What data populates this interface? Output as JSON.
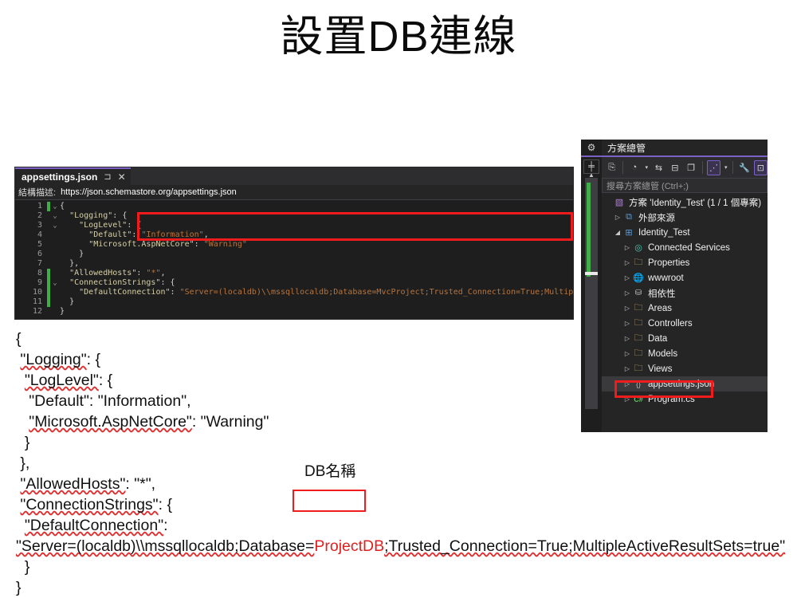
{
  "slide": {
    "title": "設置DB連線"
  },
  "editor": {
    "tab": {
      "title": "appsettings.json",
      "pin_icon": "pin-icon",
      "close_icon": "close-icon"
    },
    "schema": {
      "label": "結構描述:",
      "url": "https://json.schemastore.org/appsettings.json"
    },
    "lines": [
      {
        "num": "1",
        "fold": "⌄",
        "changed": true,
        "indent": "",
        "text": "{"
      },
      {
        "num": "2",
        "fold": "⌄",
        "changed": false,
        "indent": "",
        "text": "  \"Logging\": {"
      },
      {
        "num": "3",
        "fold": "⌄",
        "changed": false,
        "indent": "",
        "text": "    \"LogLevel\": {"
      },
      {
        "num": "4",
        "fold": "",
        "changed": false,
        "indent": "",
        "text": "      \"Default\": \"Information\","
      },
      {
        "num": "5",
        "fold": "",
        "changed": false,
        "indent": "",
        "text": "      \"Microsoft.AspNetCore\": \"Warning\""
      },
      {
        "num": "6",
        "fold": "",
        "changed": false,
        "indent": "",
        "text": "    }"
      },
      {
        "num": "7",
        "fold": "",
        "changed": false,
        "indent": "",
        "text": "  },"
      },
      {
        "num": "8",
        "fold": "",
        "changed": true,
        "indent": "",
        "text": "  \"AllowedHosts\": \"*\","
      },
      {
        "num": "9",
        "fold": "⌄",
        "changed": true,
        "indent": "",
        "text": "  \"ConnectionStrings\": {"
      },
      {
        "num": "10",
        "fold": "",
        "changed": true,
        "indent": "",
        "text": "    \"DefaultConnection\": \"Server=(localdb)\\\\mssqllocaldb;Database=MvcProject;Trusted_Connection=True;MultipleActiveResultSets=true\""
      },
      {
        "num": "11",
        "fold": "",
        "changed": true,
        "indent": "",
        "text": "  }"
      },
      {
        "num": "12",
        "fold": "",
        "changed": false,
        "indent": "",
        "text": "}"
      }
    ],
    "highlight_color": "#ee1c1c"
  },
  "solution_explorer": {
    "header": "方案總管",
    "search_placeholder": "搜尋方案總管 (Ctrl+;)",
    "gear_icon": "gear-icon",
    "pin_icon": "pin-icon",
    "toolbar": [
      {
        "name": "home-icon",
        "glyph": "⎘",
        "framed": false,
        "caret": false
      },
      {
        "name": "pending-changes-icon",
        "glyph": "◔",
        "framed": false,
        "caret": true
      },
      {
        "name": "sync-icon",
        "glyph": "⇆",
        "framed": false,
        "caret": false
      },
      {
        "name": "collapse-all-icon",
        "glyph": "⊟",
        "framed": false,
        "caret": false
      },
      {
        "name": "show-all-files-icon",
        "glyph": "❐",
        "framed": false,
        "caret": false
      },
      {
        "name": "view-switch-icon",
        "glyph": "⋰",
        "framed": true,
        "caret": true
      },
      {
        "name": "properties-icon",
        "glyph": "🔧",
        "framed": false,
        "caret": false
      },
      {
        "name": "preview-icon",
        "glyph": "⊡",
        "framed": true,
        "caret": false
      }
    ],
    "tree": [
      {
        "label": "方案 'Identity_Test' (1 / 1 個專案)",
        "depth": 0,
        "twisty": "",
        "icon": "solution-icon",
        "glyph": "▧",
        "icon_class": "sln-ico",
        "selected": false
      },
      {
        "label": "外部來源",
        "depth": 1,
        "twisty": "▷",
        "icon": "external-sources-icon",
        "glyph": "⧉",
        "icon_class": "proj-ico",
        "selected": false
      },
      {
        "label": "Identity_Test",
        "depth": 1,
        "twisty": "◢",
        "icon": "project-icon",
        "glyph": "⊞",
        "icon_class": "proj-ico",
        "selected": false
      },
      {
        "label": "Connected Services",
        "depth": 2,
        "twisty": "▷",
        "icon": "connected-services-icon",
        "glyph": "◎",
        "icon_class": "conn-ico",
        "selected": false
      },
      {
        "label": "Properties",
        "depth": 2,
        "twisty": "▷",
        "icon": "properties-folder-icon",
        "glyph": "🗀",
        "icon_class": "prop-ico",
        "selected": false
      },
      {
        "label": "wwwroot",
        "depth": 2,
        "twisty": "▷",
        "icon": "wwwroot-icon",
        "glyph": "🌐",
        "icon_class": "globe-ico",
        "selected": false
      },
      {
        "label": "相依性",
        "depth": 2,
        "twisty": "▷",
        "icon": "dependencies-icon",
        "glyph": "⛁",
        "icon_class": "dep-ico",
        "selected": false
      },
      {
        "label": "Areas",
        "depth": 2,
        "twisty": "▷",
        "icon": "folder-icon",
        "glyph": "🗀",
        "icon_class": "folder-ico",
        "selected": false
      },
      {
        "label": "Controllers",
        "depth": 2,
        "twisty": "▷",
        "icon": "folder-icon",
        "glyph": "🗀",
        "icon_class": "folder-ico",
        "selected": false
      },
      {
        "label": "Data",
        "depth": 2,
        "twisty": "▷",
        "icon": "folder-icon",
        "glyph": "🗀",
        "icon_class": "folder-ico",
        "selected": false
      },
      {
        "label": "Models",
        "depth": 2,
        "twisty": "▷",
        "icon": "folder-icon",
        "glyph": "🗀",
        "icon_class": "folder-ico",
        "selected": false
      },
      {
        "label": "Views",
        "depth": 2,
        "twisty": "▷",
        "icon": "folder-icon",
        "glyph": "🗀",
        "icon_class": "folder-ico",
        "selected": false
      },
      {
        "label": "appsettings.json",
        "depth": 2,
        "twisty": "▷",
        "icon": "json-file-icon",
        "glyph": "{}",
        "icon_class": "json-ico",
        "selected": true
      },
      {
        "label": "Program.cs",
        "depth": 2,
        "twisty": "▷",
        "icon": "csharp-file-icon",
        "glyph": "C#",
        "icon_class": "cs-ico",
        "selected": false
      }
    ]
  },
  "transcript": {
    "line1": "{",
    "line2": "  \"Logging\": {",
    "line3": "   \"LogLevel\": {",
    "line4": "     \"Default\": \"Information\",",
    "line5": "     \"Microsoft.AspNetCore\": \"Warning\"",
    "line6": "   }",
    "line7": "  },",
    "line8": "  \"AllowedHosts\": \"*\",",
    "line9": "  \"ConnectionStrings\": {",
    "line10": "   \"DefaultConnection\":",
    "line11_before": "\"Server=(localdb)\\\\mssqllocaldb;Database=",
    "line11_token": "ProjectDB",
    "line11_after": ";Trusted_Connection=True;MultipleActiveResultSets=true\"",
    "line12": "  }",
    "line13": "}"
  },
  "annotations": {
    "db_caption": "DB名稱",
    "box_color": "#ee1c1c"
  }
}
